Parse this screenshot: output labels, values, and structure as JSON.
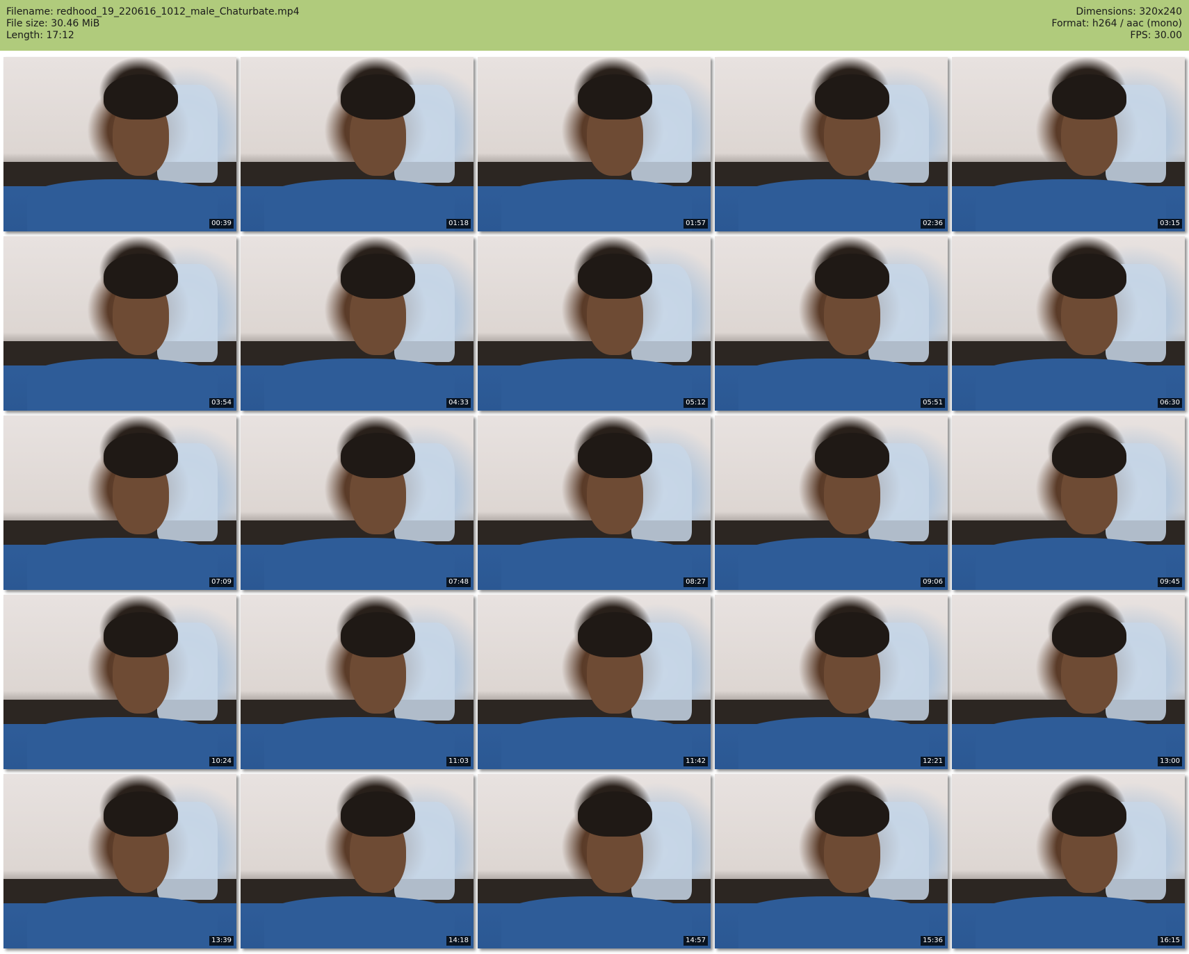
{
  "header": {
    "filename": "Filename: redhood_19_220616_1012_male_Chaturbate.mp4",
    "filesize": "File size: 30.46 MiB",
    "length": "Length: 17:12",
    "dimensions": "Dimensions: 320x240",
    "format": "Format: h264 / aac (mono)",
    "fps": "FPS: 30.00"
  },
  "colors": {
    "header_bg": "#b0cb7c",
    "timestamp_bg": "#000000"
  },
  "thumbnails": [
    {
      "time": "00:39"
    },
    {
      "time": "01:18"
    },
    {
      "time": "01:57"
    },
    {
      "time": "02:36"
    },
    {
      "time": "03:15"
    },
    {
      "time": "03:54"
    },
    {
      "time": "04:33"
    },
    {
      "time": "05:12"
    },
    {
      "time": "05:51"
    },
    {
      "time": "06:30"
    },
    {
      "time": "07:09"
    },
    {
      "time": "07:48"
    },
    {
      "time": "08:27"
    },
    {
      "time": "09:06"
    },
    {
      "time": "09:45"
    },
    {
      "time": "10:24"
    },
    {
      "time": "11:03"
    },
    {
      "time": "11:42"
    },
    {
      "time": "12:21"
    },
    {
      "time": "13:00"
    },
    {
      "time": "13:39"
    },
    {
      "time": "14:18"
    },
    {
      "time": "14:57"
    },
    {
      "time": "15:36"
    },
    {
      "time": "16:15"
    }
  ]
}
